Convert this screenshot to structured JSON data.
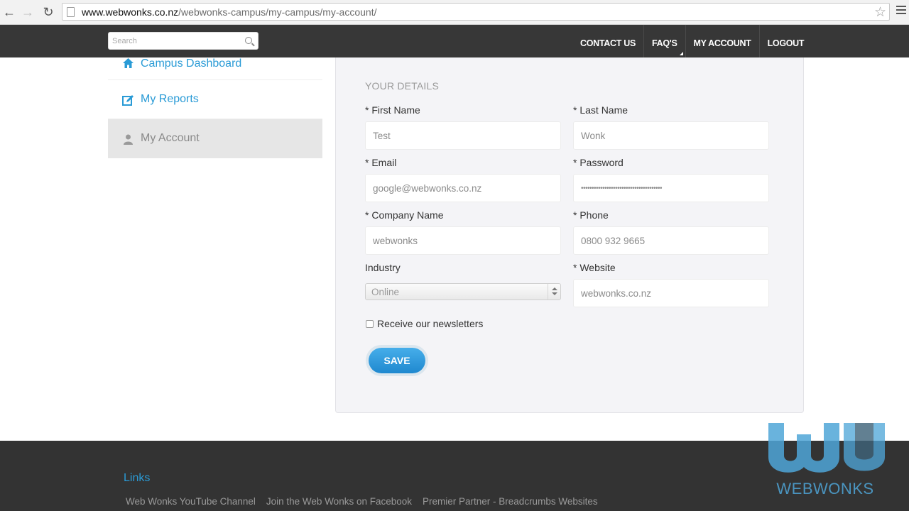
{
  "browser": {
    "url_host": "www.webwonks.co.nz",
    "url_path": "/webwonks-campus/my-campus/my-account/"
  },
  "header": {
    "search_placeholder": "Search",
    "nav": [
      "CONTACT US",
      "FAQ'S",
      "MY ACCOUNT",
      "LOGOUT"
    ]
  },
  "sidebar": {
    "items": [
      {
        "label": "Campus Dashboard",
        "icon": "home-icon"
      },
      {
        "label": "My Reports",
        "icon": "edit-icon"
      },
      {
        "label": "My Account",
        "icon": "user-icon",
        "active": true
      }
    ]
  },
  "form": {
    "section_title": "YOUR DETAILS",
    "first_name_label": "* First Name",
    "first_name_value": "Test",
    "last_name_label": "* Last Name",
    "last_name_value": "Wonk",
    "email_label": "* Email",
    "email_value": "google@webwonks.co.nz",
    "password_label": "* Password",
    "password_value": "••••••••••••••••••••••••••••••••••••••",
    "company_label": "* Company Name",
    "company_value": "webwonks",
    "phone_label": "* Phone",
    "phone_value": "0800 932 9665",
    "industry_label": "Industry",
    "industry_value": "Online",
    "website_label": "* Website",
    "website_value": "webwonks.co.nz",
    "newsletter_label": "Receive our newsletters",
    "save_label": "SAVE"
  },
  "footer": {
    "heading": "Links",
    "links": [
      "Web Wonks YouTube Channel",
      "Join the Web Wonks on Facebook",
      "Premier Partner - Breadcrumbs Websites"
    ]
  },
  "watermark": {
    "text": "WEBWONKS"
  },
  "colors": {
    "accent": "#2a9bd6",
    "header_bg": "#373737",
    "footer_bg": "#333333"
  }
}
